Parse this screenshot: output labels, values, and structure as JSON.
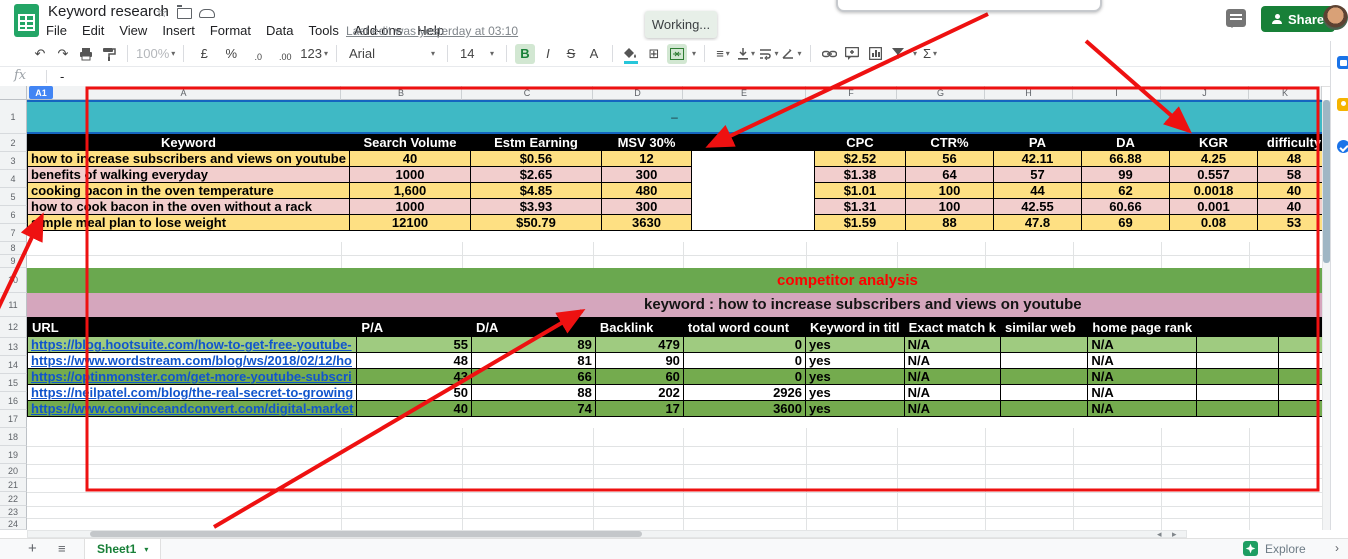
{
  "titlebar": {
    "title": "Keyword research",
    "menus": [
      "File",
      "Edit",
      "View",
      "Insert",
      "Format",
      "Data",
      "Tools",
      "Add-ons",
      "Help"
    ],
    "last_edit": "Last edit was yesterday at 03:10",
    "working_status": "Working...",
    "share_label": "Share"
  },
  "toolbar": {
    "zoom_value": "100%",
    "currency": "£",
    "percent": "%",
    "dec_decrease": ".0",
    "dec_increase": ".00",
    "format_more": "123",
    "font_family": "Arial",
    "font_size": "14",
    "bold": "B",
    "italic": "I",
    "strike": "S",
    "text_color": "A",
    "sum": "Σ"
  },
  "ui_icons": {
    "undo": "↶",
    "redo": "↷",
    "borders": "⊞",
    "align": "≡",
    "dropdown": "▾",
    "star": "☆",
    "add_sheet": "+",
    "all_sheets": "≡",
    "scroll_left": "◂",
    "scroll_right": "▸",
    "collapse": "›"
  },
  "formula_bar": {
    "name_box": "A1",
    "fx_label": "fx",
    "value": "-"
  },
  "sheet": {
    "column_letters": [
      "A",
      "B",
      "C",
      "D",
      "E",
      "F",
      "G",
      "H",
      "I",
      "J",
      "K"
    ],
    "a1_text": "–"
  },
  "keyword_table": {
    "headers": [
      "Keyword",
      "Search Volume",
      "Estm Earning",
      "MSV 30%",
      "",
      "CPC",
      "CTR%",
      "PA",
      "DA",
      "KGR",
      "difficulty"
    ],
    "rows": [
      {
        "keyword": "how to increase subscribers and views on youtube",
        "search_volume": "40",
        "estm_earning": "$0.56",
        "msv": "12",
        "cpc": "$2.52",
        "ctr": "56",
        "pa": "42.11",
        "da": "66.88",
        "kgr": "4.25",
        "difficulty": "48"
      },
      {
        "keyword": "benefits of walking everyday",
        "search_volume": "1000",
        "estm_earning": "$2.65",
        "msv": "300",
        "cpc": "$1.38",
        "ctr": "64",
        "pa": "57",
        "da": "99",
        "kgr": "0.557",
        "difficulty": "58"
      },
      {
        "keyword": "cooking bacon in the oven temperature",
        "search_volume": "1,600",
        "estm_earning": "$4.85",
        "msv": "480",
        "cpc": "$1.01",
        "ctr": "100",
        "pa": "44",
        "da": "62",
        "kgr": "0.0018",
        "difficulty": "40"
      },
      {
        "keyword": "how to cook bacon in the oven without a rack",
        "search_volume": "1000",
        "estm_earning": "$3.93",
        "msv": "300",
        "cpc": "$1.31",
        "ctr": "100",
        "pa": "42.55",
        "da": "60.66",
        "kgr": "0.001",
        "difficulty": "40"
      },
      {
        "keyword": "simple meal plan to lose weight",
        "search_volume": "12100",
        "estm_earning": "$50.79",
        "msv": "3630",
        "cpc": "$1.59",
        "ctr": "88",
        "pa": "47.8",
        "da": "69",
        "kgr": "0.08",
        "difficulty": "53"
      }
    ]
  },
  "competitor_table": {
    "section_title": "competitor analysis",
    "keyword_line": "keyword  : how to increase subscribers and views on youtube",
    "headers": [
      "URL",
      "P/A",
      "D/A",
      "Backlink",
      "total word count",
      "Keyword in titl",
      "Exact match k",
      "similar web",
      "home page rank"
    ],
    "rows": [
      {
        "url": "https://blog.hootsuite.com/how-to-get-free-youtube-",
        "pa": "55",
        "da": "89",
        "backlink": "479",
        "twc": "0",
        "kw_in_title": "yes",
        "exact_match": "N/A",
        "similar_web": "",
        "home_page_rank": "N/A"
      },
      {
        "url": "https://www.wordstream.com/blog/ws/2018/02/12/ho",
        "pa": "48",
        "da": "81",
        "backlink": "90",
        "twc": "0",
        "kw_in_title": "yes",
        "exact_match": "N/A",
        "similar_web": "",
        "home_page_rank": "N/A"
      },
      {
        "url": "https://optinmonster.com/get-more-youtube-subscri",
        "pa": "43",
        "da": "66",
        "backlink": "60",
        "twc": "0",
        "kw_in_title": "yes",
        "exact_match": "N/A",
        "similar_web": "",
        "home_page_rank": "N/A"
      },
      {
        "url": "https://neilpatel.com/blog/the-real-secret-to-growing",
        "pa": "50",
        "da": "88",
        "backlink": "202",
        "twc": "2926",
        "kw_in_title": "yes",
        "exact_match": "N/A",
        "similar_web": "",
        "home_page_rank": "N/A"
      },
      {
        "url": "https://www.convinceandconvert.com/digital-market",
        "pa": "40",
        "da": "74",
        "backlink": "17",
        "twc": "3600",
        "kw_in_title": "yes",
        "exact_match": "N/A",
        "similar_web": "",
        "home_page_rank": "N/A"
      }
    ]
  },
  "footer": {
    "sheet_tab": "Sheet1",
    "explore_label": "Explore"
  },
  "colors": {
    "teal": "#3fb9c5",
    "yellow": "#fee083",
    "pink": "#f2cecd",
    "green_band": "#6aa84f",
    "pink_band": "#d5a6bd",
    "row_light_green": "#9fcb80",
    "row_dark_green": "#74ab4e",
    "link_blue": "#1155cc",
    "annotation_red": "#ee1111",
    "share_green": "#188038",
    "competitor_title_red": "#ff0000"
  }
}
